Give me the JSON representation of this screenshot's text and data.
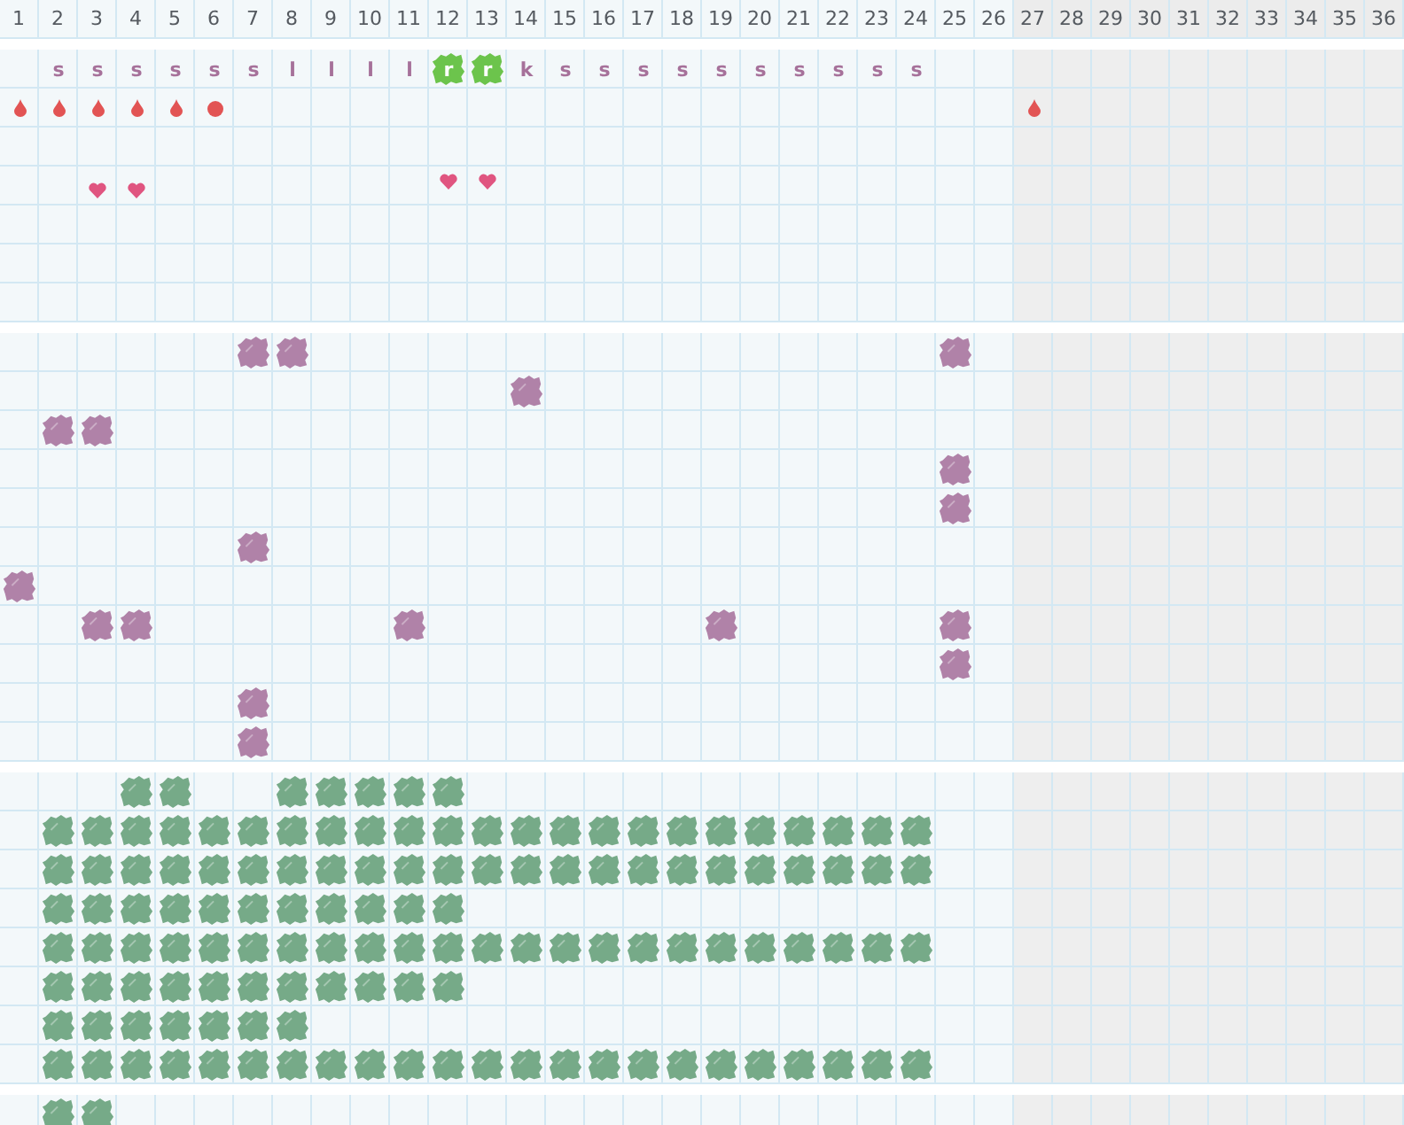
{
  "columns": [
    {
      "label": "1",
      "shaded": false
    },
    {
      "label": "2",
      "shaded": false
    },
    {
      "label": "3",
      "shaded": false
    },
    {
      "label": "4",
      "shaded": false
    },
    {
      "label": "5",
      "shaded": false
    },
    {
      "label": "6",
      "shaded": false
    },
    {
      "label": "7",
      "shaded": false
    },
    {
      "label": "8",
      "shaded": false
    },
    {
      "label": "9",
      "shaded": false
    },
    {
      "label": "10",
      "shaded": false
    },
    {
      "label": "11",
      "shaded": false
    },
    {
      "label": "12",
      "shaded": false
    },
    {
      "label": "13",
      "shaded": false
    },
    {
      "label": "14",
      "shaded": false
    },
    {
      "label": "15",
      "shaded": false
    },
    {
      "label": "16",
      "shaded": false
    },
    {
      "label": "17",
      "shaded": false
    },
    {
      "label": "18",
      "shaded": false
    },
    {
      "label": "19",
      "shaded": false
    },
    {
      "label": "20",
      "shaded": false
    },
    {
      "label": "21",
      "shaded": false
    },
    {
      "label": "22",
      "shaded": false
    },
    {
      "label": "23",
      "shaded": false
    },
    {
      "label": "24",
      "shaded": false
    },
    {
      "label": "25",
      "shaded": false
    },
    {
      "label": "26",
      "shaded": false
    },
    {
      "label": "27",
      "shaded": true
    },
    {
      "label": "28",
      "shaded": true
    },
    {
      "label": "29",
      "shaded": true
    },
    {
      "label": "30",
      "shaded": true
    },
    {
      "label": "31",
      "shaded": true
    },
    {
      "label": "32",
      "shaded": true
    },
    {
      "label": "33",
      "shaded": true
    },
    {
      "label": "34",
      "shaded": true
    },
    {
      "label": "35",
      "shaded": true
    },
    {
      "label": "36",
      "shaded": true
    }
  ],
  "sections": [
    {
      "rows": [
        {
          "cells": [
            {
              "kind": "none"
            },
            {
              "kind": "letter",
              "text": "s"
            },
            {
              "kind": "letter",
              "text": "s"
            },
            {
              "kind": "letter",
              "text": "s"
            },
            {
              "kind": "letter",
              "text": "s"
            },
            {
              "kind": "letter",
              "text": "s"
            },
            {
              "kind": "letter",
              "text": "s"
            },
            {
              "kind": "letter",
              "text": "l"
            },
            {
              "kind": "letter",
              "text": "l"
            },
            {
              "kind": "letter",
              "text": "l"
            },
            {
              "kind": "letter",
              "text": "l"
            },
            {
              "kind": "tile",
              "text": "r"
            },
            {
              "kind": "tile",
              "text": "r"
            },
            {
              "kind": "letter",
              "text": "k"
            },
            {
              "kind": "letter",
              "text": "s"
            },
            {
              "kind": "letter",
              "text": "s"
            },
            {
              "kind": "letter",
              "text": "s"
            },
            {
              "kind": "letter",
              "text": "s"
            },
            {
              "kind": "letter",
              "text": "s"
            },
            {
              "kind": "letter",
              "text": "s"
            },
            {
              "kind": "letter",
              "text": "s"
            },
            {
              "kind": "letter",
              "text": "s"
            },
            {
              "kind": "letter",
              "text": "s"
            },
            {
              "kind": "letter",
              "text": "s"
            }
          ]
        },
        {
          "cells": [
            {
              "kind": "drop"
            },
            {
              "kind": "drop"
            },
            {
              "kind": "drop"
            },
            {
              "kind": "drop"
            },
            {
              "kind": "drop"
            },
            {
              "kind": "dot"
            },
            {
              "kind": "none"
            },
            {
              "kind": "none"
            },
            {
              "kind": "none"
            },
            {
              "kind": "none"
            },
            {
              "kind": "none"
            },
            {
              "kind": "none"
            },
            {
              "kind": "none"
            },
            {
              "kind": "none"
            },
            {
              "kind": "none"
            },
            {
              "kind": "none"
            },
            {
              "kind": "none"
            },
            {
              "kind": "none"
            },
            {
              "kind": "none"
            },
            {
              "kind": "none"
            },
            {
              "kind": "none"
            },
            {
              "kind": "none"
            },
            {
              "kind": "none"
            },
            {
              "kind": "none"
            },
            {
              "kind": "none"
            },
            {
              "kind": "none"
            },
            {
              "kind": "drop"
            }
          ]
        },
        {},
        {
          "cells": [
            {
              "kind": "none"
            },
            {
              "kind": "none"
            },
            {
              "kind": "heart_low"
            },
            {
              "kind": "heart_low"
            },
            {
              "kind": "none"
            },
            {
              "kind": "none"
            },
            {
              "kind": "none"
            },
            {
              "kind": "none"
            },
            {
              "kind": "none"
            },
            {
              "kind": "none"
            },
            {
              "kind": "none"
            },
            {
              "kind": "heart"
            },
            {
              "kind": "heart"
            }
          ]
        },
        {},
        {},
        {}
      ]
    },
    {
      "rows": [
        {
          "cells": [
            {
              "kind": "none"
            },
            {
              "kind": "none"
            },
            {
              "kind": "none"
            },
            {
              "kind": "none"
            },
            {
              "kind": "none"
            },
            {
              "kind": "none"
            },
            {
              "kind": "plum"
            },
            {
              "kind": "plum"
            },
            {
              "kind": "none"
            },
            {
              "kind": "none"
            },
            {
              "kind": "none"
            },
            {
              "kind": "none"
            },
            {
              "kind": "none"
            },
            {
              "kind": "none"
            },
            {
              "kind": "none"
            },
            {
              "kind": "none"
            },
            {
              "kind": "none"
            },
            {
              "kind": "none"
            },
            {
              "kind": "none"
            },
            {
              "kind": "none"
            },
            {
              "kind": "none"
            },
            {
              "kind": "none"
            },
            {
              "kind": "none"
            },
            {
              "kind": "none"
            },
            {
              "kind": "plum"
            }
          ]
        },
        {
          "cells": [
            {
              "kind": "none"
            },
            {
              "kind": "none"
            },
            {
              "kind": "none"
            },
            {
              "kind": "none"
            },
            {
              "kind": "none"
            },
            {
              "kind": "none"
            },
            {
              "kind": "none"
            },
            {
              "kind": "none"
            },
            {
              "kind": "none"
            },
            {
              "kind": "none"
            },
            {
              "kind": "none"
            },
            {
              "kind": "none"
            },
            {
              "kind": "none"
            },
            {
              "kind": "plum"
            }
          ]
        },
        {
          "cells": [
            {
              "kind": "none"
            },
            {
              "kind": "plum"
            },
            {
              "kind": "plum"
            }
          ]
        },
        {
          "cells": [
            {
              "kind": "none"
            },
            {
              "kind": "none"
            },
            {
              "kind": "none"
            },
            {
              "kind": "none"
            },
            {
              "kind": "none"
            },
            {
              "kind": "none"
            },
            {
              "kind": "none"
            },
            {
              "kind": "none"
            },
            {
              "kind": "none"
            },
            {
              "kind": "none"
            },
            {
              "kind": "none"
            },
            {
              "kind": "none"
            },
            {
              "kind": "none"
            },
            {
              "kind": "none"
            },
            {
              "kind": "none"
            },
            {
              "kind": "none"
            },
            {
              "kind": "none"
            },
            {
              "kind": "none"
            },
            {
              "kind": "none"
            },
            {
              "kind": "none"
            },
            {
              "kind": "none"
            },
            {
              "kind": "none"
            },
            {
              "kind": "none"
            },
            {
              "kind": "none"
            },
            {
              "kind": "plum"
            }
          ]
        },
        {
          "cells": [
            {
              "kind": "none"
            },
            {
              "kind": "none"
            },
            {
              "kind": "none"
            },
            {
              "kind": "none"
            },
            {
              "kind": "none"
            },
            {
              "kind": "none"
            },
            {
              "kind": "none"
            },
            {
              "kind": "none"
            },
            {
              "kind": "none"
            },
            {
              "kind": "none"
            },
            {
              "kind": "none"
            },
            {
              "kind": "none"
            },
            {
              "kind": "none"
            },
            {
              "kind": "none"
            },
            {
              "kind": "none"
            },
            {
              "kind": "none"
            },
            {
              "kind": "none"
            },
            {
              "kind": "none"
            },
            {
              "kind": "none"
            },
            {
              "kind": "none"
            },
            {
              "kind": "none"
            },
            {
              "kind": "none"
            },
            {
              "kind": "none"
            },
            {
              "kind": "none"
            },
            {
              "kind": "plum"
            }
          ]
        },
        {
          "cells": [
            {
              "kind": "none"
            },
            {
              "kind": "none"
            },
            {
              "kind": "none"
            },
            {
              "kind": "none"
            },
            {
              "kind": "none"
            },
            {
              "kind": "none"
            },
            {
              "kind": "plum"
            }
          ]
        },
        {
          "cells": [
            {
              "kind": "plum"
            }
          ]
        },
        {
          "cells": [
            {
              "kind": "none"
            },
            {
              "kind": "none"
            },
            {
              "kind": "plum"
            },
            {
              "kind": "plum"
            },
            {
              "kind": "none"
            },
            {
              "kind": "none"
            },
            {
              "kind": "none"
            },
            {
              "kind": "none"
            },
            {
              "kind": "none"
            },
            {
              "kind": "none"
            },
            {
              "kind": "plum"
            },
            {
              "kind": "none"
            },
            {
              "kind": "none"
            },
            {
              "kind": "none"
            },
            {
              "kind": "none"
            },
            {
              "kind": "none"
            },
            {
              "kind": "none"
            },
            {
              "kind": "none"
            },
            {
              "kind": "plum"
            },
            {
              "kind": "none"
            },
            {
              "kind": "none"
            },
            {
              "kind": "none"
            },
            {
              "kind": "none"
            },
            {
              "kind": "none"
            },
            {
              "kind": "plum"
            }
          ]
        },
        {
          "cells": [
            {
              "kind": "none"
            },
            {
              "kind": "none"
            },
            {
              "kind": "none"
            },
            {
              "kind": "none"
            },
            {
              "kind": "none"
            },
            {
              "kind": "none"
            },
            {
              "kind": "none"
            },
            {
              "kind": "none"
            },
            {
              "kind": "none"
            },
            {
              "kind": "none"
            },
            {
              "kind": "none"
            },
            {
              "kind": "none"
            },
            {
              "kind": "none"
            },
            {
              "kind": "none"
            },
            {
              "kind": "none"
            },
            {
              "kind": "none"
            },
            {
              "kind": "none"
            },
            {
              "kind": "none"
            },
            {
              "kind": "none"
            },
            {
              "kind": "none"
            },
            {
              "kind": "none"
            },
            {
              "kind": "none"
            },
            {
              "kind": "none"
            },
            {
              "kind": "none"
            },
            {
              "kind": "plum"
            }
          ]
        },
        {
          "cells": [
            {
              "kind": "none"
            },
            {
              "kind": "none"
            },
            {
              "kind": "none"
            },
            {
              "kind": "none"
            },
            {
              "kind": "none"
            },
            {
              "kind": "none"
            },
            {
              "kind": "plum"
            }
          ]
        },
        {
          "cells": [
            {
              "kind": "none"
            },
            {
              "kind": "none"
            },
            {
              "kind": "none"
            },
            {
              "kind": "none"
            },
            {
              "kind": "none"
            },
            {
              "kind": "none"
            },
            {
              "kind": "plum"
            }
          ]
        }
      ]
    },
    {
      "rows": [
        {
          "cells": [
            {
              "kind": "none"
            },
            {
              "kind": "none"
            },
            {
              "kind": "none"
            },
            {
              "kind": "sage"
            },
            {
              "kind": "sage"
            },
            {
              "kind": "none"
            },
            {
              "kind": "none"
            },
            {
              "kind": "sage"
            },
            {
              "kind": "sage"
            },
            {
              "kind": "sage"
            },
            {
              "kind": "sage"
            },
            {
              "kind": "sage"
            }
          ]
        },
        {
          "cells": [
            {
              "kind": "none"
            },
            {
              "kind": "sage"
            },
            {
              "kind": "sage"
            },
            {
              "kind": "sage"
            },
            {
              "kind": "sage"
            },
            {
              "kind": "sage"
            },
            {
              "kind": "sage"
            },
            {
              "kind": "sage"
            },
            {
              "kind": "sage"
            },
            {
              "kind": "sage"
            },
            {
              "kind": "sage"
            },
            {
              "kind": "sage"
            },
            {
              "kind": "sage"
            },
            {
              "kind": "sage"
            },
            {
              "kind": "sage"
            },
            {
              "kind": "sage"
            },
            {
              "kind": "sage"
            },
            {
              "kind": "sage"
            },
            {
              "kind": "sage"
            },
            {
              "kind": "sage"
            },
            {
              "kind": "sage"
            },
            {
              "kind": "sage"
            },
            {
              "kind": "sage"
            },
            {
              "kind": "sage"
            }
          ]
        },
        {
          "cells": [
            {
              "kind": "none"
            },
            {
              "kind": "sage"
            },
            {
              "kind": "sage"
            },
            {
              "kind": "sage"
            },
            {
              "kind": "sage"
            },
            {
              "kind": "sage"
            },
            {
              "kind": "sage"
            },
            {
              "kind": "sage"
            },
            {
              "kind": "sage"
            },
            {
              "kind": "sage"
            },
            {
              "kind": "sage"
            },
            {
              "kind": "sage"
            },
            {
              "kind": "sage"
            },
            {
              "kind": "sage"
            },
            {
              "kind": "sage"
            },
            {
              "kind": "sage"
            },
            {
              "kind": "sage"
            },
            {
              "kind": "sage"
            },
            {
              "kind": "sage"
            },
            {
              "kind": "sage"
            },
            {
              "kind": "sage"
            },
            {
              "kind": "sage"
            },
            {
              "kind": "sage"
            },
            {
              "kind": "sage"
            }
          ]
        },
        {
          "cells": [
            {
              "kind": "none"
            },
            {
              "kind": "sage"
            },
            {
              "kind": "sage"
            },
            {
              "kind": "sage"
            },
            {
              "kind": "sage"
            },
            {
              "kind": "sage"
            },
            {
              "kind": "sage"
            },
            {
              "kind": "sage"
            },
            {
              "kind": "sage"
            },
            {
              "kind": "sage"
            },
            {
              "kind": "sage"
            },
            {
              "kind": "sage"
            }
          ]
        },
        {
          "cells": [
            {
              "kind": "none"
            },
            {
              "kind": "sage"
            },
            {
              "kind": "sage"
            },
            {
              "kind": "sage"
            },
            {
              "kind": "sage"
            },
            {
              "kind": "sage"
            },
            {
              "kind": "sage"
            },
            {
              "kind": "sage"
            },
            {
              "kind": "sage"
            },
            {
              "kind": "sage"
            },
            {
              "kind": "sage"
            },
            {
              "kind": "sage"
            },
            {
              "kind": "sage"
            },
            {
              "kind": "sage"
            },
            {
              "kind": "sage"
            },
            {
              "kind": "sage"
            },
            {
              "kind": "sage"
            },
            {
              "kind": "sage"
            },
            {
              "kind": "sage"
            },
            {
              "kind": "sage"
            },
            {
              "kind": "sage"
            },
            {
              "kind": "sage"
            },
            {
              "kind": "sage"
            },
            {
              "kind": "sage"
            }
          ]
        },
        {
          "cells": [
            {
              "kind": "none"
            },
            {
              "kind": "sage"
            },
            {
              "kind": "sage"
            },
            {
              "kind": "sage"
            },
            {
              "kind": "sage"
            },
            {
              "kind": "sage"
            },
            {
              "kind": "sage"
            },
            {
              "kind": "sage"
            },
            {
              "kind": "sage"
            },
            {
              "kind": "sage"
            },
            {
              "kind": "sage"
            },
            {
              "kind": "sage"
            }
          ]
        },
        {
          "cells": [
            {
              "kind": "none"
            },
            {
              "kind": "sage"
            },
            {
              "kind": "sage"
            },
            {
              "kind": "sage"
            },
            {
              "kind": "sage"
            },
            {
              "kind": "sage"
            },
            {
              "kind": "sage"
            },
            {
              "kind": "sage"
            }
          ]
        },
        {
          "cells": [
            {
              "kind": "none"
            },
            {
              "kind": "sage"
            },
            {
              "kind": "sage"
            },
            {
              "kind": "sage"
            },
            {
              "kind": "sage"
            },
            {
              "kind": "sage"
            },
            {
              "kind": "sage"
            },
            {
              "kind": "sage"
            },
            {
              "kind": "sage"
            },
            {
              "kind": "sage"
            },
            {
              "kind": "sage"
            },
            {
              "kind": "sage"
            },
            {
              "kind": "sage"
            },
            {
              "kind": "sage"
            },
            {
              "kind": "sage"
            },
            {
              "kind": "sage"
            },
            {
              "kind": "sage"
            },
            {
              "kind": "sage"
            },
            {
              "kind": "sage"
            },
            {
              "kind": "sage"
            },
            {
              "kind": "sage"
            },
            {
              "kind": "sage"
            },
            {
              "kind": "sage"
            },
            {
              "kind": "sage"
            }
          ]
        }
      ]
    },
    {
      "rows": [
        {
          "cells": [
            {
              "kind": "none"
            },
            {
              "kind": "sage"
            },
            {
              "kind": "sage"
            }
          ]
        }
      ]
    }
  ]
}
